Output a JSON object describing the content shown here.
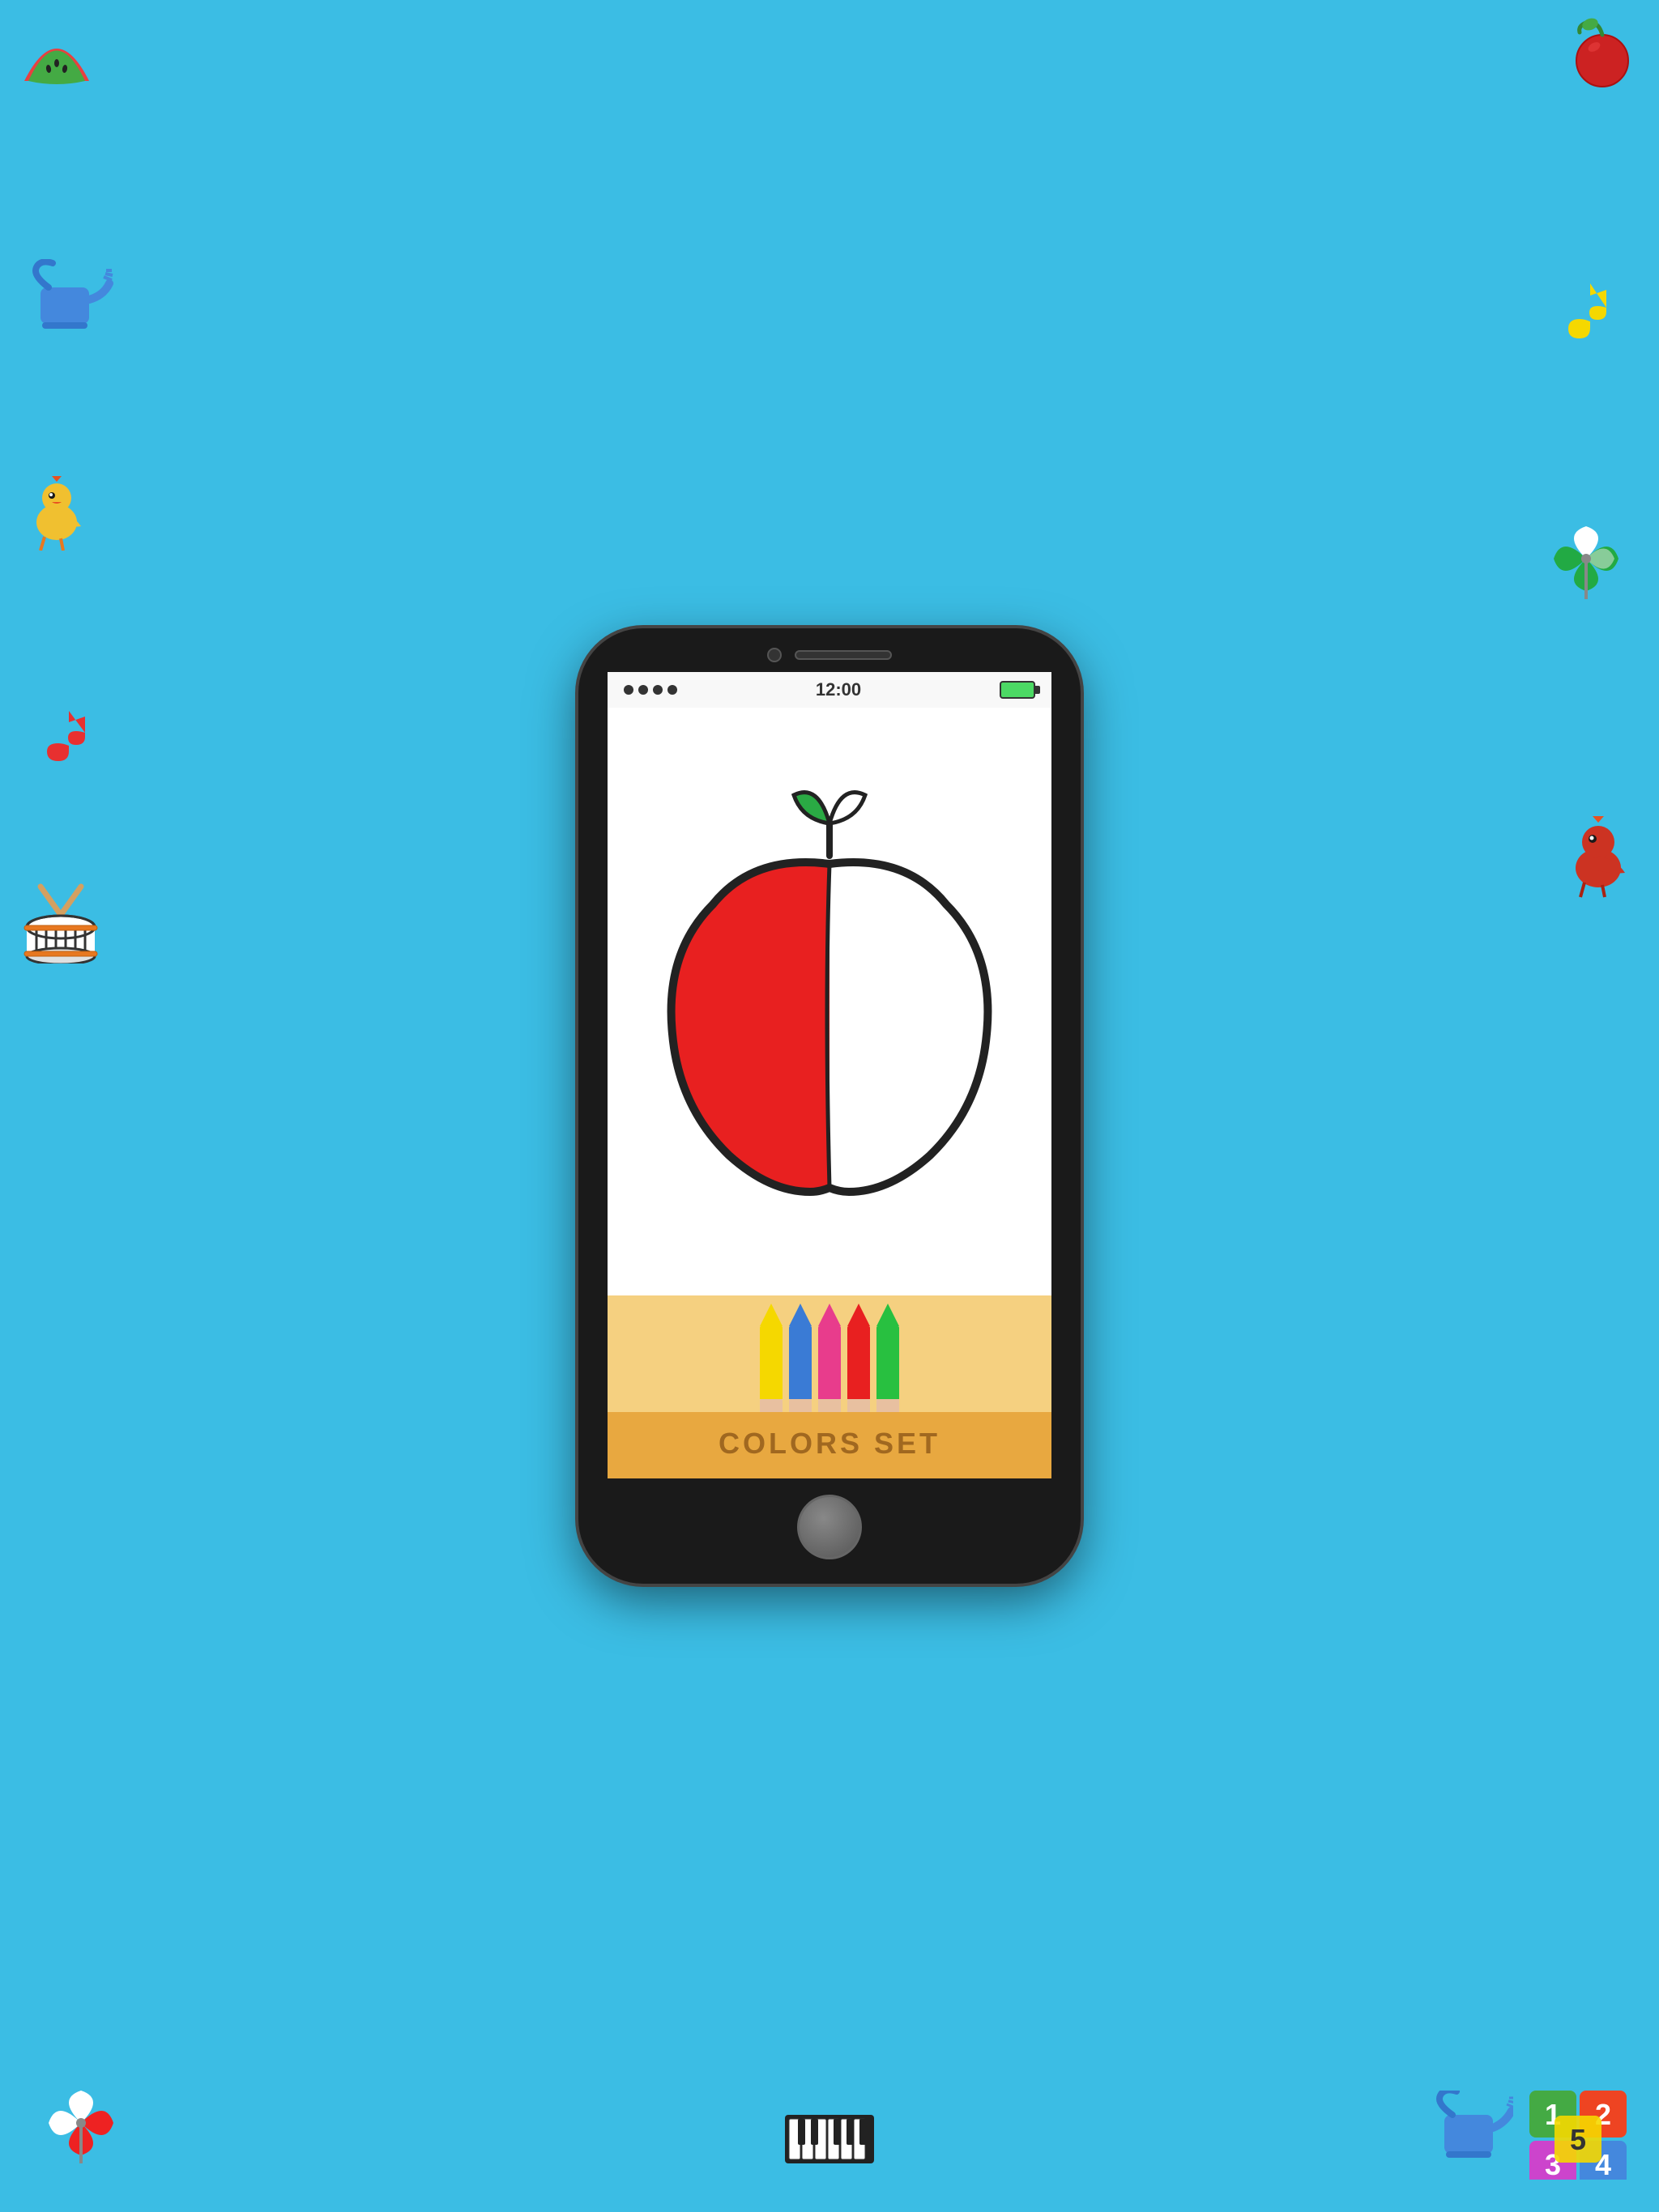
{
  "background": {
    "color": "#3bbde4"
  },
  "phone": {
    "status_bar": {
      "time": "12:00",
      "dots_count": 4
    },
    "colors_set_label": "COLORS SET",
    "pencils": [
      {
        "color": "#f5d800",
        "tip_color": "#f0c800",
        "label": "yellow"
      },
      {
        "color": "#3a7bd5",
        "tip_color": "#2a6bc5",
        "label": "blue"
      },
      {
        "color": "#e83c8c",
        "tip_color": "#d82c7c",
        "label": "pink"
      },
      {
        "color": "#e82020",
        "tip_color": "#d81010",
        "label": "red"
      },
      {
        "color": "#28c040",
        "tip_color": "#18b030",
        "label": "green"
      }
    ]
  },
  "decorations": {
    "watermelon": "🍉",
    "cherry": "🍒",
    "music_note": "♪",
    "rooster": "🐓",
    "drum": "🥁",
    "pinwheel": "🎡",
    "piano": "🎹",
    "watering_can": "🪣",
    "number_blocks": "123"
  }
}
